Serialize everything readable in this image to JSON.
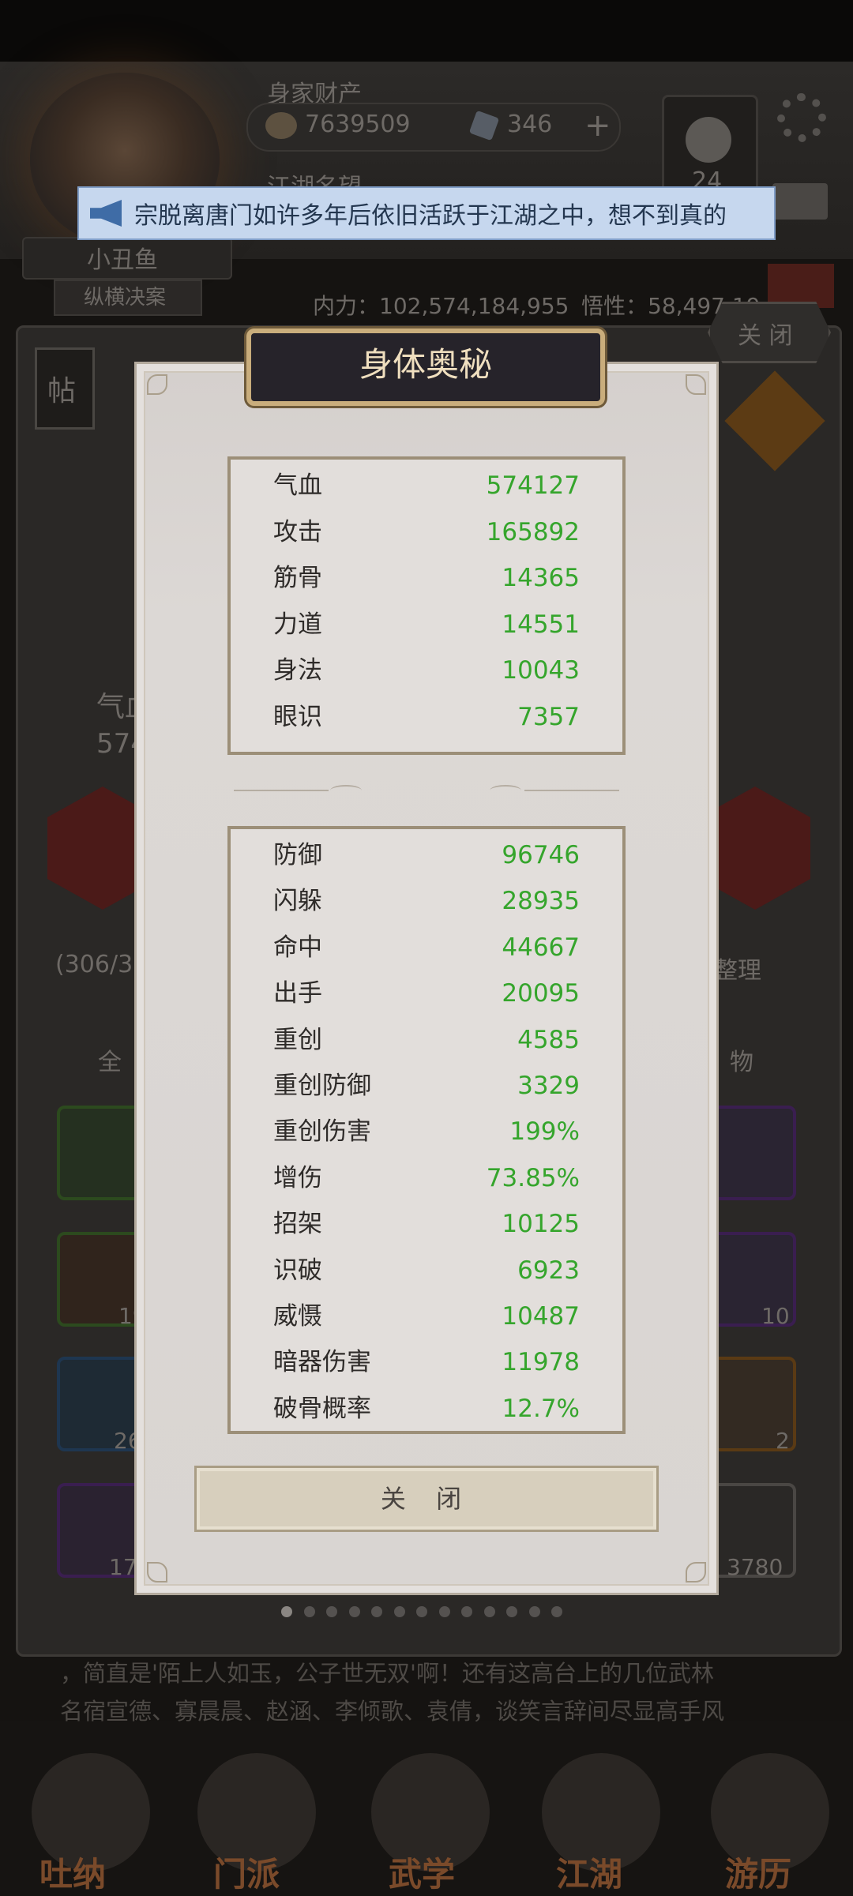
{
  "background": {
    "assets_label": "身家财产",
    "silver": "7639509",
    "jade": "346",
    "fame_label": "江湖名望",
    "yy_count": "24",
    "player_name": "小丑鱼",
    "player_title": "纵横决案",
    "neili": "内力：102,574,184,955",
    "wuxing": "悟性：58,497,19",
    "close_chip": "关 闭",
    "tie_chip": "帖",
    "hp_label": "气血",
    "hp_prefix": "574",
    "bag_count": "(306/3",
    "sort_button": "整理",
    "tab_all": "全",
    "tab_item": "物",
    "slot_counts": [
      "19",
      "10",
      "26",
      "2",
      "17",
      "3780"
    ],
    "bottom_text_1": "，简直是'陌上人如玉，公子世无双'啊！还有这高台上的几位武林",
    "bottom_text_2": "名宿宣德、寡晨晨、赵涵、李倾歌、袁倩，谈笑言辞间尽显高手风"
  },
  "announcement": {
    "icon": "speaker-icon",
    "text": "宗脱离唐门如许多年后依旧活跃于江湖之中，想不到真的"
  },
  "dialog": {
    "title": "身体奥秘",
    "group1": [
      {
        "name": "气血",
        "value": "574127"
      },
      {
        "name": "攻击",
        "value": "165892"
      },
      {
        "name": "筋骨",
        "value": "14365"
      },
      {
        "name": "力道",
        "value": "14551"
      },
      {
        "name": "身法",
        "value": "10043"
      },
      {
        "name": "眼识",
        "value": "7357"
      }
    ],
    "group2": [
      {
        "name": "防御",
        "value": "96746"
      },
      {
        "name": "闪躲",
        "value": "28935"
      },
      {
        "name": "命中",
        "value": "44667"
      },
      {
        "name": "出手",
        "value": "20095"
      },
      {
        "name": "重创",
        "value": "4585"
      },
      {
        "name": "重创防御",
        "value": "3329"
      },
      {
        "name": "重创伤害",
        "value": "199%"
      },
      {
        "name": "增伤",
        "value": "73.85%"
      },
      {
        "name": "招架",
        "value": "10125"
      },
      {
        "name": "识破",
        "value": "6923"
      },
      {
        "name": "威慑",
        "value": "10487"
      },
      {
        "name": "暗器伤害",
        "value": "11978"
      },
      {
        "name": "破骨概率",
        "value": "12.7%"
      }
    ],
    "close_button": "关 闭"
  },
  "pager": {
    "count": 13,
    "active": 0
  },
  "bottom_nav": [
    "吐纳",
    "门派",
    "武学",
    "江湖",
    "游历"
  ],
  "colors": {
    "stat_value": "#35a52c",
    "title_text": "#f0dfbf",
    "announce_bg": "#c6d7ee"
  }
}
